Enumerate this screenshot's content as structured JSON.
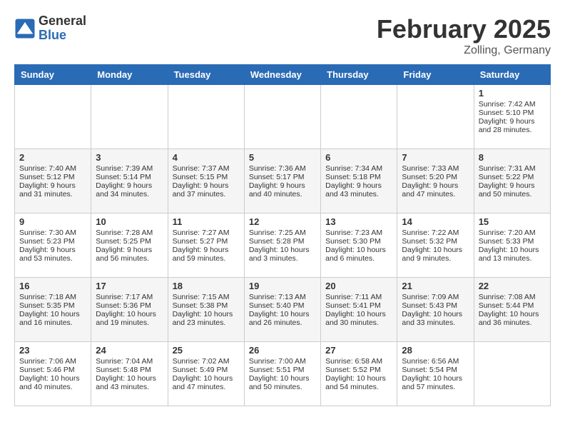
{
  "header": {
    "logo_general": "General",
    "logo_blue": "Blue",
    "month_title": "February 2025",
    "location": "Zolling, Germany"
  },
  "days_of_week": [
    "Sunday",
    "Monday",
    "Tuesday",
    "Wednesday",
    "Thursday",
    "Friday",
    "Saturday"
  ],
  "weeks": [
    [
      {
        "day": "",
        "info": ""
      },
      {
        "day": "",
        "info": ""
      },
      {
        "day": "",
        "info": ""
      },
      {
        "day": "",
        "info": ""
      },
      {
        "day": "",
        "info": ""
      },
      {
        "day": "",
        "info": ""
      },
      {
        "day": "1",
        "info": "Sunrise: 7:42 AM\nSunset: 5:10 PM\nDaylight: 9 hours and 28 minutes."
      }
    ],
    [
      {
        "day": "2",
        "info": "Sunrise: 7:40 AM\nSunset: 5:12 PM\nDaylight: 9 hours and 31 minutes."
      },
      {
        "day": "3",
        "info": "Sunrise: 7:39 AM\nSunset: 5:14 PM\nDaylight: 9 hours and 34 minutes."
      },
      {
        "day": "4",
        "info": "Sunrise: 7:37 AM\nSunset: 5:15 PM\nDaylight: 9 hours and 37 minutes."
      },
      {
        "day": "5",
        "info": "Sunrise: 7:36 AM\nSunset: 5:17 PM\nDaylight: 9 hours and 40 minutes."
      },
      {
        "day": "6",
        "info": "Sunrise: 7:34 AM\nSunset: 5:18 PM\nDaylight: 9 hours and 43 minutes."
      },
      {
        "day": "7",
        "info": "Sunrise: 7:33 AM\nSunset: 5:20 PM\nDaylight: 9 hours and 47 minutes."
      },
      {
        "day": "8",
        "info": "Sunrise: 7:31 AM\nSunset: 5:22 PM\nDaylight: 9 hours and 50 minutes."
      }
    ],
    [
      {
        "day": "9",
        "info": "Sunrise: 7:30 AM\nSunset: 5:23 PM\nDaylight: 9 hours and 53 minutes."
      },
      {
        "day": "10",
        "info": "Sunrise: 7:28 AM\nSunset: 5:25 PM\nDaylight: 9 hours and 56 minutes."
      },
      {
        "day": "11",
        "info": "Sunrise: 7:27 AM\nSunset: 5:27 PM\nDaylight: 9 hours and 59 minutes."
      },
      {
        "day": "12",
        "info": "Sunrise: 7:25 AM\nSunset: 5:28 PM\nDaylight: 10 hours and 3 minutes."
      },
      {
        "day": "13",
        "info": "Sunrise: 7:23 AM\nSunset: 5:30 PM\nDaylight: 10 hours and 6 minutes."
      },
      {
        "day": "14",
        "info": "Sunrise: 7:22 AM\nSunset: 5:32 PM\nDaylight: 10 hours and 9 minutes."
      },
      {
        "day": "15",
        "info": "Sunrise: 7:20 AM\nSunset: 5:33 PM\nDaylight: 10 hours and 13 minutes."
      }
    ],
    [
      {
        "day": "16",
        "info": "Sunrise: 7:18 AM\nSunset: 5:35 PM\nDaylight: 10 hours and 16 minutes."
      },
      {
        "day": "17",
        "info": "Sunrise: 7:17 AM\nSunset: 5:36 PM\nDaylight: 10 hours and 19 minutes."
      },
      {
        "day": "18",
        "info": "Sunrise: 7:15 AM\nSunset: 5:38 PM\nDaylight: 10 hours and 23 minutes."
      },
      {
        "day": "19",
        "info": "Sunrise: 7:13 AM\nSunset: 5:40 PM\nDaylight: 10 hours and 26 minutes."
      },
      {
        "day": "20",
        "info": "Sunrise: 7:11 AM\nSunset: 5:41 PM\nDaylight: 10 hours and 30 minutes."
      },
      {
        "day": "21",
        "info": "Sunrise: 7:09 AM\nSunset: 5:43 PM\nDaylight: 10 hours and 33 minutes."
      },
      {
        "day": "22",
        "info": "Sunrise: 7:08 AM\nSunset: 5:44 PM\nDaylight: 10 hours and 36 minutes."
      }
    ],
    [
      {
        "day": "23",
        "info": "Sunrise: 7:06 AM\nSunset: 5:46 PM\nDaylight: 10 hours and 40 minutes."
      },
      {
        "day": "24",
        "info": "Sunrise: 7:04 AM\nSunset: 5:48 PM\nDaylight: 10 hours and 43 minutes."
      },
      {
        "day": "25",
        "info": "Sunrise: 7:02 AM\nSunset: 5:49 PM\nDaylight: 10 hours and 47 minutes."
      },
      {
        "day": "26",
        "info": "Sunrise: 7:00 AM\nSunset: 5:51 PM\nDaylight: 10 hours and 50 minutes."
      },
      {
        "day": "27",
        "info": "Sunrise: 6:58 AM\nSunset: 5:52 PM\nDaylight: 10 hours and 54 minutes."
      },
      {
        "day": "28",
        "info": "Sunrise: 6:56 AM\nSunset: 5:54 PM\nDaylight: 10 hours and 57 minutes."
      },
      {
        "day": "",
        "info": ""
      }
    ]
  ]
}
